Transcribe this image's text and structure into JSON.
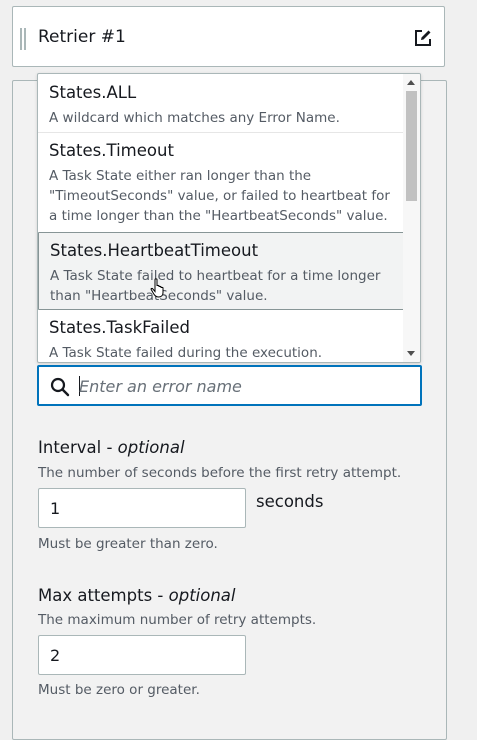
{
  "retrier": {
    "title": "Retrier #1"
  },
  "error_options": [
    {
      "name": "States.ALL",
      "description": "A wildcard which matches any Error Name."
    },
    {
      "name": "States.Timeout",
      "description": "A Task State either ran longer than the \"TimeoutSeconds\" value, or failed to heartbeat for a time longer than the \"HeartbeatSeconds\" value."
    },
    {
      "name": "States.HeartbeatTimeout",
      "description": "A Task State failed to heartbeat for a time longer than \"HeartbeatSeconds\" value."
    },
    {
      "name": "States.TaskFailed",
      "description": "A Task State failed during the execution."
    }
  ],
  "search": {
    "placeholder": "Enter an error name",
    "value": ""
  },
  "interval": {
    "label": "Interval",
    "optional": "optional",
    "description": "The number of seconds before the first retry attempt.",
    "value": "1",
    "unit": "seconds",
    "hint": "Must be greater than zero."
  },
  "max_attempts": {
    "label": "Max attempts",
    "optional": "optional",
    "description": "The maximum number of retry attempts.",
    "value": "2",
    "hint": "Must be zero or greater."
  },
  "colors": {
    "accent": "#0073bb",
    "border": "#aab7b8",
    "text": "#16191f",
    "muted": "#545b64"
  }
}
